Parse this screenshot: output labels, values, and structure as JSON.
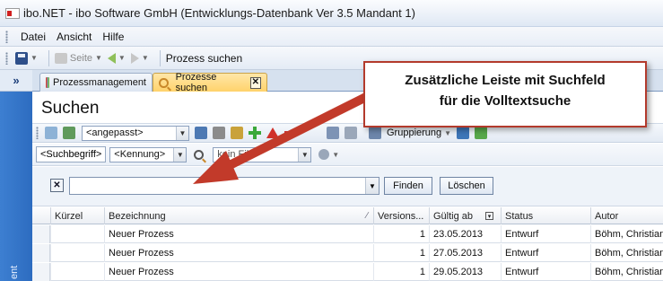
{
  "window": {
    "title": "ibo.NET - ibo Software GmbH (Entwicklungs-Datenbank Ver 3.5 Mandant 1)"
  },
  "menu": {
    "items": [
      "Datei",
      "Ansicht",
      "Hilfe"
    ]
  },
  "toolbar": {
    "page_label": "Seite",
    "location_text": "Prozess suchen"
  },
  "leftnav": {
    "expand_label": "»",
    "vertical_text": "ent"
  },
  "tabs": [
    {
      "label": "Prozessmanagement",
      "active": false
    },
    {
      "label": "Prozesse suchen",
      "active": true,
      "close_label": "✕"
    }
  ],
  "search_panel": {
    "heading": "Suchen",
    "view_select": "<angepasst>",
    "grouping_label": "Gruppierung",
    "filter_searchterm": "<Suchbegriff>",
    "filter_id": "<Kennung>",
    "filter_partial": "kein Fil",
    "search_value": "",
    "find_button": "Finden",
    "clear_button": "Löschen",
    "clear_x": "✕"
  },
  "grid": {
    "columns": [
      "Kürzel",
      "Bezeichnung",
      "Versions...",
      "Gültig ab",
      "Status",
      "Autor"
    ],
    "rows": [
      {
        "kuerzel": "",
        "bezeichnung": "Neuer Prozess",
        "version": "1",
        "gueltig": "23.05.2013",
        "status": "Entwurf",
        "autor": "Böhm, Christian"
      },
      {
        "kuerzel": "",
        "bezeichnung": "Neuer Prozess",
        "version": "1",
        "gueltig": "27.05.2013",
        "status": "Entwurf",
        "autor": "Böhm, Christian"
      },
      {
        "kuerzel": "",
        "bezeichnung": "Neuer Prozess",
        "version": "1",
        "gueltig": "29.05.2013",
        "status": "Entwurf",
        "autor": "Böhm, Christian"
      }
    ]
  },
  "callout": {
    "line1": "Zusätzliche Leiste mit Suchfeld",
    "line2": "für die Volltextsuche",
    "border_color": "#b33a2c",
    "arrow_color": "#c23a2a"
  }
}
